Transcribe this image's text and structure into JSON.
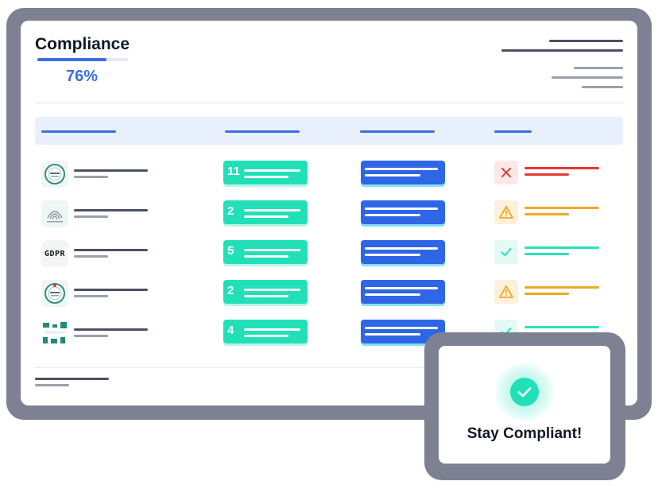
{
  "header": {
    "title": "Compliance",
    "percent_label": "76%",
    "progress": 0.76
  },
  "rows": [
    {
      "badge": "certification-seal-icon",
      "count": "11",
      "status": "fail"
    },
    {
      "badge": "fingerprint-seal-icon",
      "count": "2",
      "status": "warning"
    },
    {
      "badge": "gdpr-logo",
      "badge_text": "GDPR",
      "count": "5",
      "status": "pass"
    },
    {
      "badge": "certification-seal-icon",
      "count": "2",
      "status": "warning"
    },
    {
      "badge": "pattern-seal-icon",
      "count": "4",
      "status": "pass"
    }
  ],
  "overlay": {
    "message": "Stay Compliant!",
    "icon": "check-circle-icon"
  },
  "colors": {
    "accent_blue": "#2f66e6",
    "teal": "#21e0b8",
    "fail_red": "#e53935",
    "warning_amber": "#f0a824",
    "pass_teal": "#27e3b7",
    "frame_gray": "#7d8191"
  }
}
